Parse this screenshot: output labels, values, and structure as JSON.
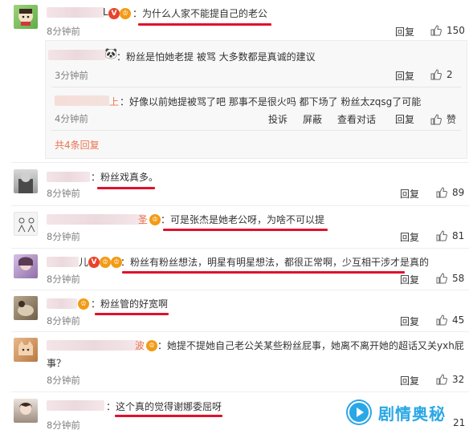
{
  "comments": [
    {
      "id": "c1",
      "text": "：为什么人家不能提自己的老公",
      "time": "8分钟前",
      "reply": "回复",
      "likes": "150"
    },
    {
      "id": "c2",
      "text": "：粉丝戏真多。",
      "time": "8分钟前",
      "reply": "回复",
      "likes": "89"
    },
    {
      "id": "c3",
      "text": "：可是张杰是她老公呀，为啥不可以提",
      "time": "8分钟前",
      "reply": "回复",
      "likes": "81"
    },
    {
      "id": "c4",
      "text": "：粉丝有粉丝想法，明星有明星想法，都很正常啊，少互相干涉才是真的",
      "time": "8分钟前",
      "reply": "回复",
      "likes": "58"
    },
    {
      "id": "c5",
      "text": "：粉丝管的好宽啊",
      "time": "8分钟前",
      "reply": "回复",
      "likes": "45"
    },
    {
      "id": "c6",
      "text_line1": "：她提不提她自己老公关某些粉丝屁事，她离不离开她的超话又关yxh屁",
      "text_line2": "事？",
      "time": "8分钟前",
      "reply": "回复",
      "likes": "32"
    },
    {
      "id": "c7",
      "text": "：这个真的觉得谢娜委屈呀",
      "time": "8分钟前",
      "likes": "21"
    }
  ],
  "sub_replies": [
    {
      "text": "：粉丝是怕她老提 被骂 大多数都是真诚的建议",
      "time": "3分钟前",
      "reply": "回复",
      "likes": "2"
    },
    {
      "name_tail": "上",
      "text": "：好像以前她提被骂了吧 那事不是很火吗 都下场了 粉丝太zqsg了可能",
      "time": "4分钟前",
      "actions": [
        "投诉",
        "屏蔽",
        "查看对话",
        "回复"
      ],
      "likes": "赞"
    }
  ],
  "more_replies": "共4条回复",
  "watermark": "剧情奥秘",
  "colors": {
    "underline": "#e0112b",
    "orange": "#eb7350",
    "watermark": "#2aa7e6"
  }
}
